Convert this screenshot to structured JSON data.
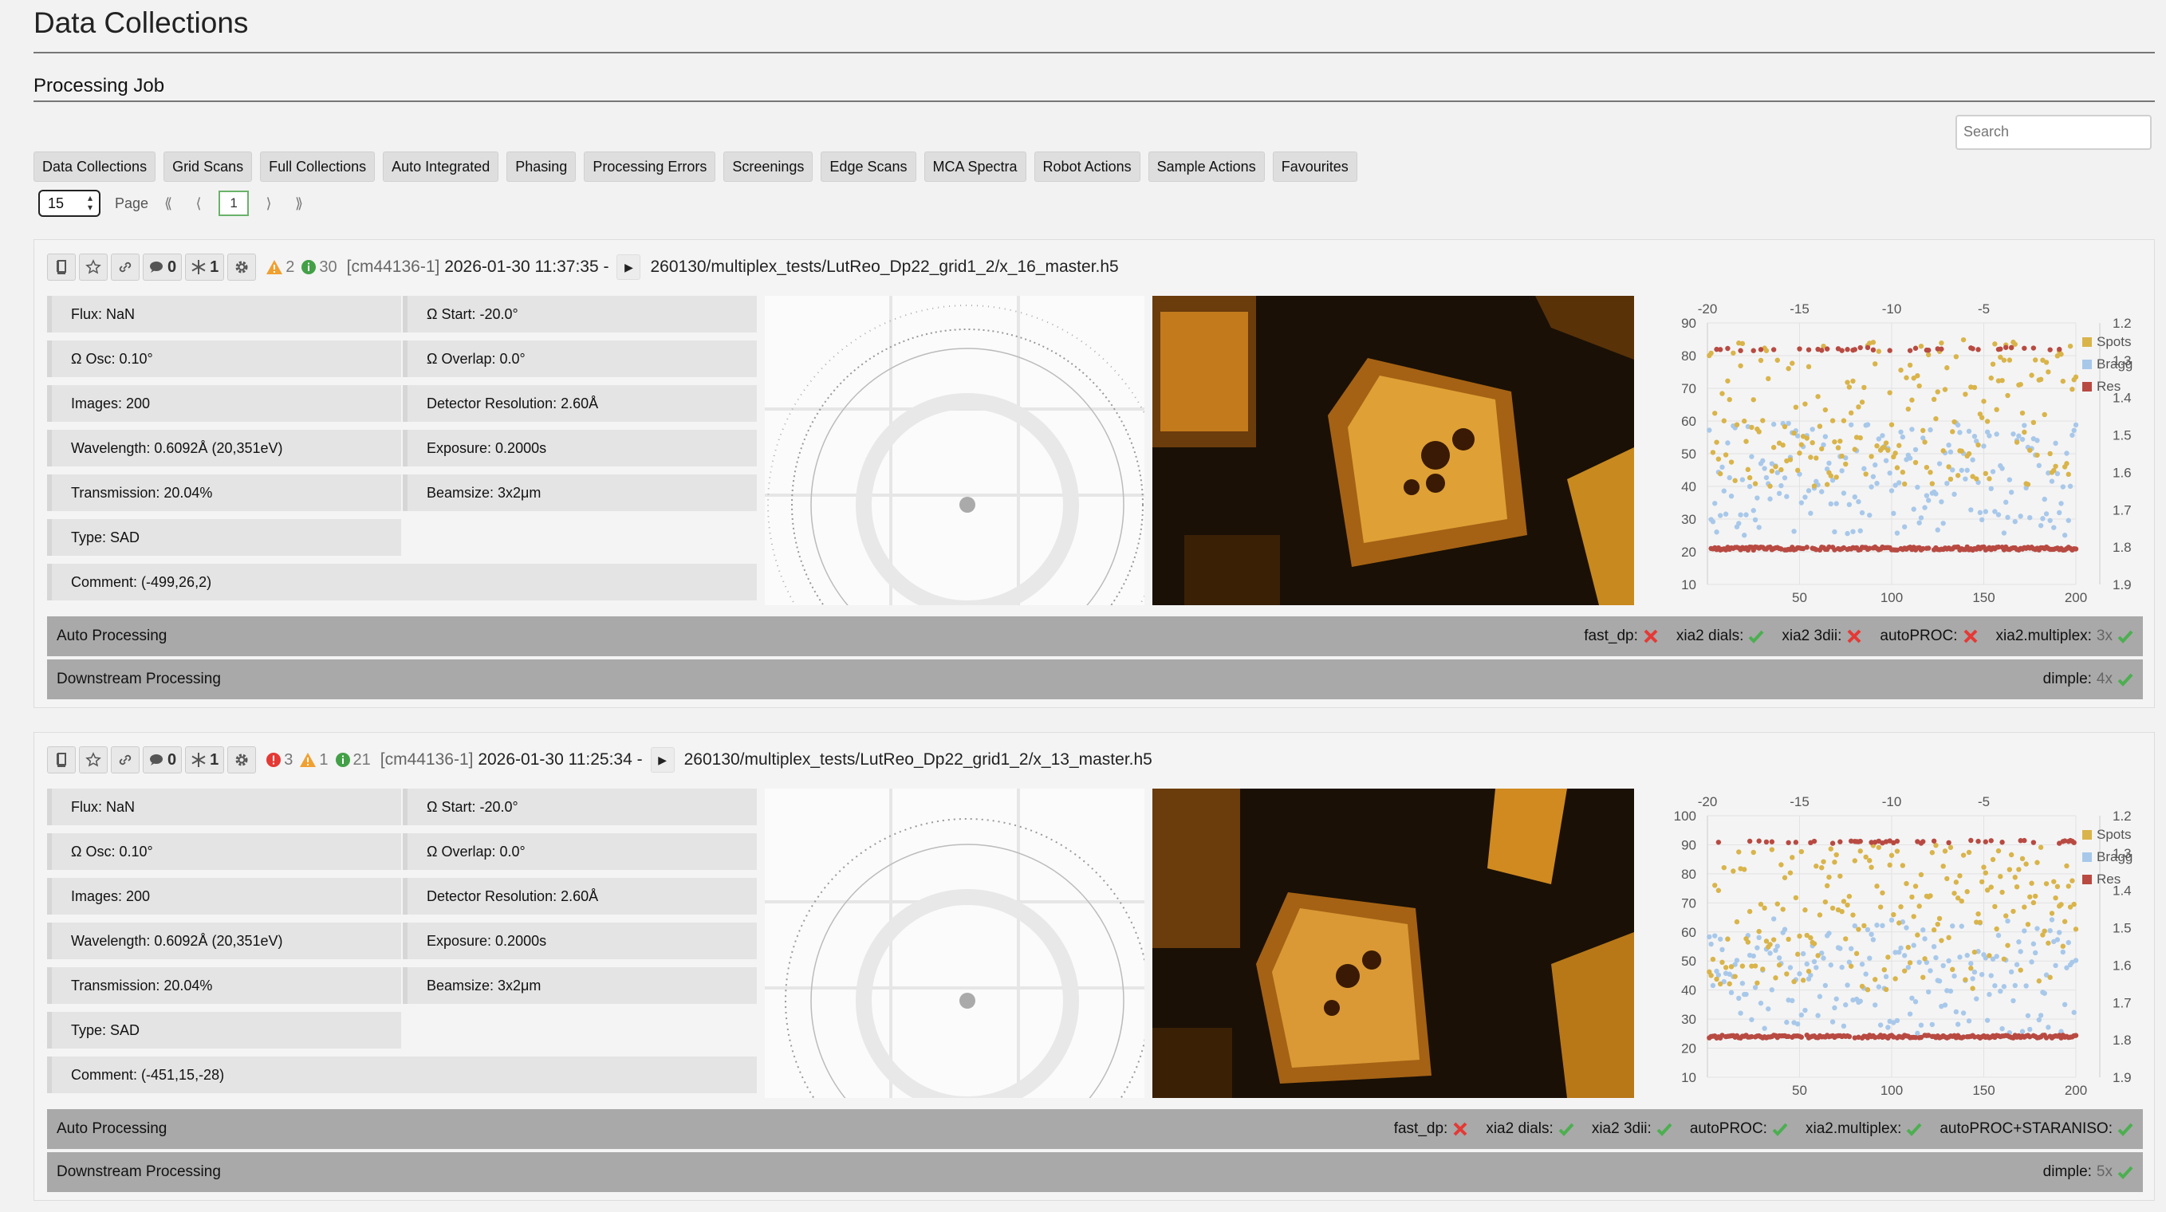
{
  "page": {
    "title": "Data Collections",
    "section": "Processing Job"
  },
  "search": {
    "placeholder": "Search"
  },
  "tabs": [
    "Data Collections",
    "Grid Scans",
    "Full Collections",
    "Auto Integrated",
    "Phasing",
    "Processing Errors",
    "Screenings",
    "Edge Scans",
    "MCA Spectra",
    "Robot Actions",
    "Sample Actions",
    "Favourites"
  ],
  "pager": {
    "page_size": "15",
    "label": "Page",
    "first": "⟪",
    "prev": "⟨",
    "current": "1",
    "next": "⟩",
    "last": "⟫"
  },
  "colors": {
    "spots": "#d9b44a",
    "bragg": "#a8c8ea",
    "res": "#b84a42",
    "ok": "#4caf50",
    "fail": "#e53935",
    "warn": "#f0a030",
    "info": "#43a047"
  },
  "collections": [
    {
      "comments": "0",
      "samples": "1",
      "status": [
        {
          "kind": "warn",
          "count": "2"
        },
        {
          "kind": "info",
          "count": "30"
        }
      ],
      "prop": "[cm44136-1]",
      "datetime": "2026-01-30 11:37:35 -",
      "path": "260130/multiplex_tests/LutReo_Dp22_grid1_2/x_16_master.h5",
      "left_params": [
        "Flux: NaN",
        "Ω Osc: 0.10°",
        "Images: 200",
        "Wavelength: 0.6092Å (20,351eV)",
        "Transmission: 20.04%",
        "Type: SAD",
        "Comment: (-499,26,2)"
      ],
      "right_params": [
        "Ω Start: -20.0°",
        "Ω Overlap: 0.0°",
        "Detector Resolution: 2.60Å",
        "Exposure: 0.2000s",
        "Beamsize: 3x2μm"
      ],
      "auto_label": "Auto Processing",
      "auto": [
        {
          "name": "fast_dp:",
          "status": "fail",
          "count": ""
        },
        {
          "name": "xia2 dials:",
          "status": "ok",
          "count": ""
        },
        {
          "name": "xia2 3dii:",
          "status": "fail",
          "count": ""
        },
        {
          "name": "autoPROC:",
          "status": "fail",
          "count": ""
        },
        {
          "name": "xia2.multiplex:",
          "status": "ok",
          "count": "3x"
        }
      ],
      "downstream_label": "Downstream Processing",
      "downstream": [
        {
          "name": "dimple:",
          "status": "ok",
          "count": "4x"
        }
      ],
      "plot": {
        "y_ticks": [
          "90",
          "80",
          "70",
          "60",
          "50",
          "40",
          "30",
          "20",
          "10"
        ],
        "y2_ticks": [
          "1.2",
          "1.3",
          "1.4",
          "1.5",
          "1.6",
          "1.7",
          "1.8",
          "1.9"
        ],
        "x_bottom": [
          "50",
          "100",
          "150",
          "200"
        ],
        "x_top": [
          "-20",
          "-15",
          "-10",
          "-5"
        ]
      }
    },
    {
      "comments": "0",
      "samples": "1",
      "status": [
        {
          "kind": "fail",
          "count": "3"
        },
        {
          "kind": "warn",
          "count": "1"
        },
        {
          "kind": "info",
          "count": "21"
        }
      ],
      "prop": "[cm44136-1]",
      "datetime": "2026-01-30 11:25:34 -",
      "path": "260130/multiplex_tests/LutReo_Dp22_grid1_2/x_13_master.h5",
      "left_params": [
        "Flux: NaN",
        "Ω Osc: 0.10°",
        "Images: 200",
        "Wavelength: 0.6092Å (20,351eV)",
        "Transmission: 20.04%",
        "Type: SAD",
        "Comment: (-451,15,-28)"
      ],
      "right_params": [
        "Ω Start: -20.0°",
        "Ω Overlap: 0.0°",
        "Detector Resolution: 2.60Å",
        "Exposure: 0.2000s",
        "Beamsize: 3x2μm"
      ],
      "auto_label": "Auto Processing",
      "auto": [
        {
          "name": "fast_dp:",
          "status": "fail",
          "count": ""
        },
        {
          "name": "xia2 dials:",
          "status": "ok",
          "count": ""
        },
        {
          "name": "xia2 3dii:",
          "status": "ok",
          "count": ""
        },
        {
          "name": "autoPROC:",
          "status": "ok",
          "count": ""
        },
        {
          "name": "xia2.multiplex:",
          "status": "ok",
          "count": ""
        },
        {
          "name": "autoPROC+STARANISO:",
          "status": "ok",
          "count": ""
        }
      ],
      "downstream_label": "Downstream Processing",
      "downstream": [
        {
          "name": "dimple:",
          "status": "ok",
          "count": "5x"
        }
      ],
      "plot": {
        "y_ticks": [
          "100",
          "90",
          "80",
          "70",
          "60",
          "50",
          "40",
          "30",
          "20",
          "10"
        ],
        "y2_ticks": [
          "1.2",
          "1.3",
          "1.4",
          "1.5",
          "1.6",
          "1.7",
          "1.8",
          "1.9"
        ],
        "x_bottom": [
          "50",
          "100",
          "150",
          "200"
        ],
        "x_top": [
          "-20",
          "-15",
          "-10",
          "-5"
        ]
      }
    }
  ],
  "chart_data": [
    {
      "type": "scatter",
      "x": [
        1,
        200
      ],
      "series": [
        {
          "name": "Spots",
          "y_range": [
            40,
            85
          ]
        },
        {
          "name": "Bragg",
          "y_range": [
            25,
            60
          ]
        },
        {
          "name": "Res",
          "y_levels": [
            21,
            82
          ]
        }
      ],
      "xlim": [
        0,
        200
      ],
      "ylim": [
        10,
        90
      ],
      "y2lim": [
        1.2,
        1.9
      ],
      "x2lim": [
        -20,
        0
      ],
      "legend": "top-right",
      "grid": true
    },
    {
      "type": "scatter",
      "x": [
        1,
        200
      ],
      "series": [
        {
          "name": "Spots",
          "y_range": [
            40,
            90
          ]
        },
        {
          "name": "Bragg",
          "y_range": [
            25,
            65
          ]
        },
        {
          "name": "Res",
          "y_levels": [
            24,
            91
          ]
        }
      ],
      "xlim": [
        0,
        200
      ],
      "ylim": [
        10,
        100
      ],
      "y2lim": [
        1.2,
        1.9
      ],
      "x2lim": [
        -20,
        0
      ],
      "legend": "top-right",
      "grid": true
    }
  ]
}
